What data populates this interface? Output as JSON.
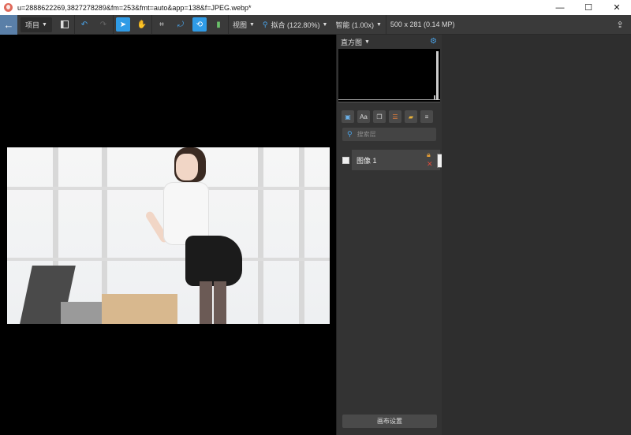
{
  "window": {
    "title": "u=2888622269,3827278289&fm=253&fmt=auto&app=138&f=JPEG.webp*",
    "controls": {
      "minimize": "—",
      "maximize": "☐",
      "close": "✕"
    }
  },
  "toolbar": {
    "back": "←",
    "project_label": "项目",
    "view_label": "视图",
    "zoom_label": "拟合 (122.80%)",
    "smart_label": "智能 (1.00x)",
    "image_info": "500 x 281 (0.14 MP)",
    "icons": [
      "panel-icon",
      "undo-icon",
      "redo-icon",
      "select-icon",
      "hand-icon",
      "crop-icon",
      "rotate-icon",
      "transform-icon",
      "compare-icon",
      "search-icon",
      "share-icon"
    ]
  },
  "panel": {
    "histogram_label": "直方图",
    "search_placeholder": "搜索层",
    "layer_name": "图像 1",
    "canvas_settings_label": "画布设置",
    "layer_tool_icons": [
      "image-icon",
      "text-icon",
      "layer-copy-icon",
      "adjust-icon",
      "folder-icon",
      "menu-icon"
    ]
  },
  "colors": {
    "accent": "#2f9be6",
    "toolbar_bg": "#3a3a3a",
    "panel_bg": "#333333",
    "canvas_bg": "#000000"
  }
}
